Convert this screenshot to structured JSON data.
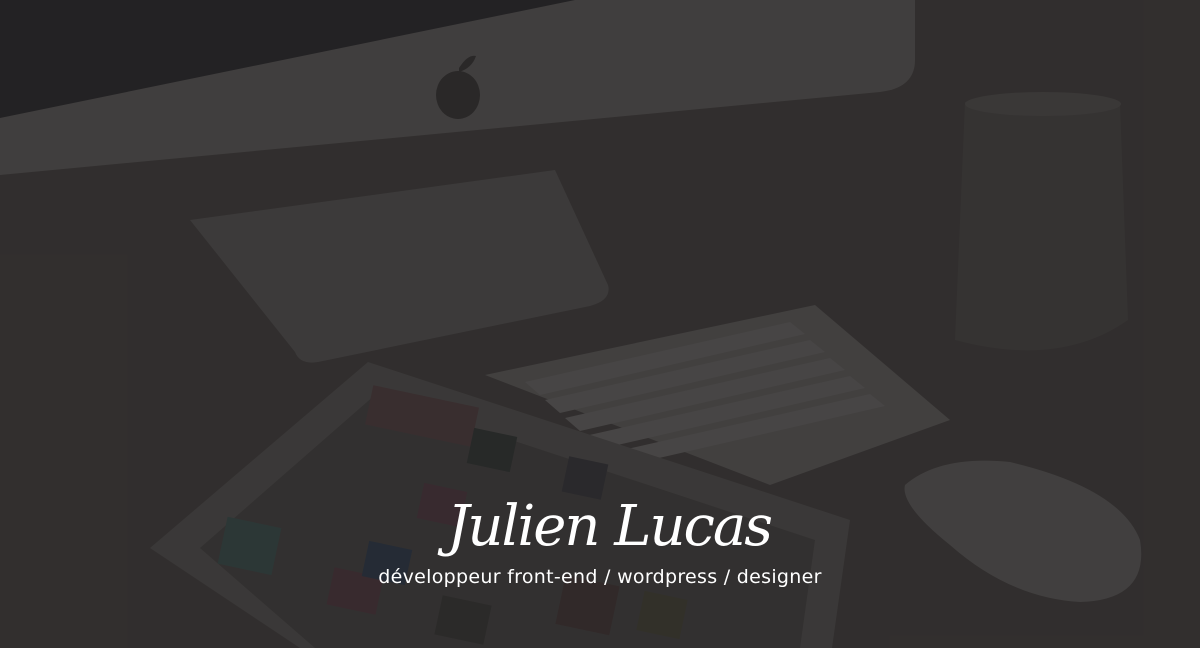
{
  "hero": {
    "name": "Julien Lucas",
    "tagline": "développeur front-end / wordpress / designer",
    "overlay_color": "#1e1c1c",
    "scene": {
      "desk_color": "#4a4645",
      "device_color": "#6b6968",
      "screen_color": "#2b2b2f"
    }
  }
}
